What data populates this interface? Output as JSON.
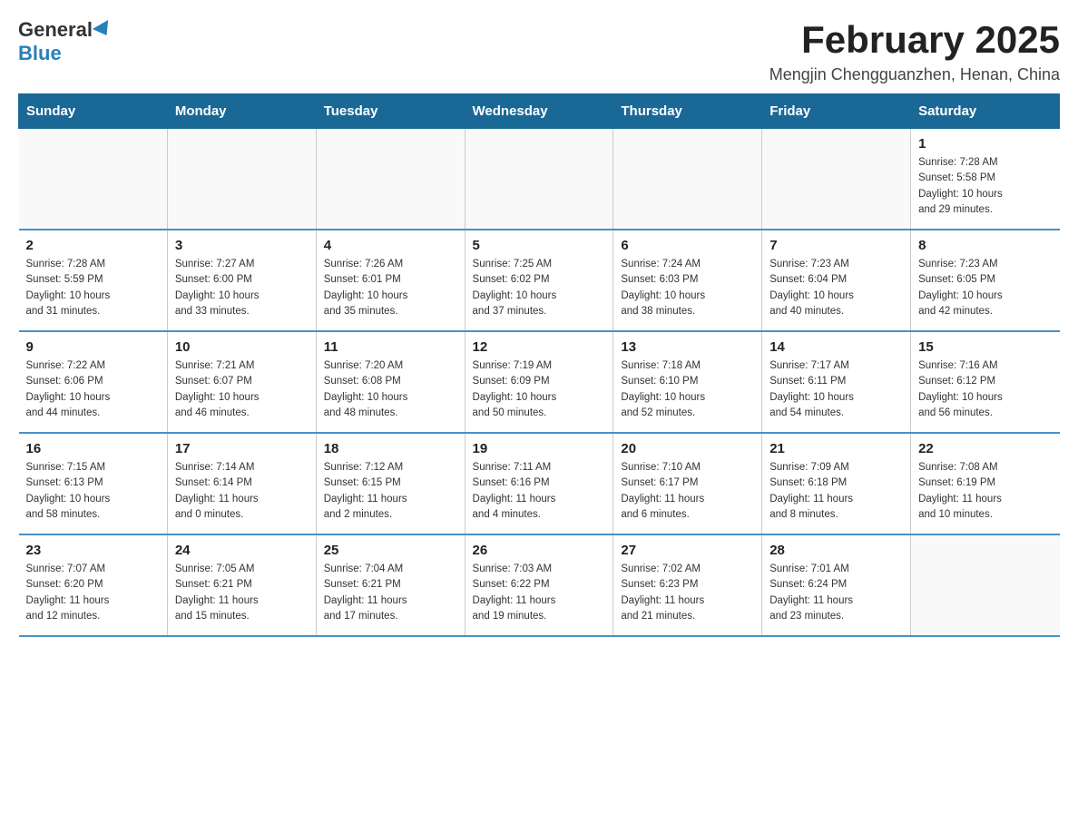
{
  "logo": {
    "general": "General",
    "blue": "Blue"
  },
  "title": "February 2025",
  "location": "Mengjin Chengguanzhen, Henan, China",
  "days_of_week": [
    "Sunday",
    "Monday",
    "Tuesday",
    "Wednesday",
    "Thursday",
    "Friday",
    "Saturday"
  ],
  "weeks": [
    {
      "days": [
        {
          "date": "",
          "info": ""
        },
        {
          "date": "",
          "info": ""
        },
        {
          "date": "",
          "info": ""
        },
        {
          "date": "",
          "info": ""
        },
        {
          "date": "",
          "info": ""
        },
        {
          "date": "",
          "info": ""
        },
        {
          "date": "1",
          "info": "Sunrise: 7:28 AM\nSunset: 5:58 PM\nDaylight: 10 hours\nand 29 minutes."
        }
      ]
    },
    {
      "days": [
        {
          "date": "2",
          "info": "Sunrise: 7:28 AM\nSunset: 5:59 PM\nDaylight: 10 hours\nand 31 minutes."
        },
        {
          "date": "3",
          "info": "Sunrise: 7:27 AM\nSunset: 6:00 PM\nDaylight: 10 hours\nand 33 minutes."
        },
        {
          "date": "4",
          "info": "Sunrise: 7:26 AM\nSunset: 6:01 PM\nDaylight: 10 hours\nand 35 minutes."
        },
        {
          "date": "5",
          "info": "Sunrise: 7:25 AM\nSunset: 6:02 PM\nDaylight: 10 hours\nand 37 minutes."
        },
        {
          "date": "6",
          "info": "Sunrise: 7:24 AM\nSunset: 6:03 PM\nDaylight: 10 hours\nand 38 minutes."
        },
        {
          "date": "7",
          "info": "Sunrise: 7:23 AM\nSunset: 6:04 PM\nDaylight: 10 hours\nand 40 minutes."
        },
        {
          "date": "8",
          "info": "Sunrise: 7:23 AM\nSunset: 6:05 PM\nDaylight: 10 hours\nand 42 minutes."
        }
      ]
    },
    {
      "days": [
        {
          "date": "9",
          "info": "Sunrise: 7:22 AM\nSunset: 6:06 PM\nDaylight: 10 hours\nand 44 minutes."
        },
        {
          "date": "10",
          "info": "Sunrise: 7:21 AM\nSunset: 6:07 PM\nDaylight: 10 hours\nand 46 minutes."
        },
        {
          "date": "11",
          "info": "Sunrise: 7:20 AM\nSunset: 6:08 PM\nDaylight: 10 hours\nand 48 minutes."
        },
        {
          "date": "12",
          "info": "Sunrise: 7:19 AM\nSunset: 6:09 PM\nDaylight: 10 hours\nand 50 minutes."
        },
        {
          "date": "13",
          "info": "Sunrise: 7:18 AM\nSunset: 6:10 PM\nDaylight: 10 hours\nand 52 minutes."
        },
        {
          "date": "14",
          "info": "Sunrise: 7:17 AM\nSunset: 6:11 PM\nDaylight: 10 hours\nand 54 minutes."
        },
        {
          "date": "15",
          "info": "Sunrise: 7:16 AM\nSunset: 6:12 PM\nDaylight: 10 hours\nand 56 minutes."
        }
      ]
    },
    {
      "days": [
        {
          "date": "16",
          "info": "Sunrise: 7:15 AM\nSunset: 6:13 PM\nDaylight: 10 hours\nand 58 minutes."
        },
        {
          "date": "17",
          "info": "Sunrise: 7:14 AM\nSunset: 6:14 PM\nDaylight: 11 hours\nand 0 minutes."
        },
        {
          "date": "18",
          "info": "Sunrise: 7:12 AM\nSunset: 6:15 PM\nDaylight: 11 hours\nand 2 minutes."
        },
        {
          "date": "19",
          "info": "Sunrise: 7:11 AM\nSunset: 6:16 PM\nDaylight: 11 hours\nand 4 minutes."
        },
        {
          "date": "20",
          "info": "Sunrise: 7:10 AM\nSunset: 6:17 PM\nDaylight: 11 hours\nand 6 minutes."
        },
        {
          "date": "21",
          "info": "Sunrise: 7:09 AM\nSunset: 6:18 PM\nDaylight: 11 hours\nand 8 minutes."
        },
        {
          "date": "22",
          "info": "Sunrise: 7:08 AM\nSunset: 6:19 PM\nDaylight: 11 hours\nand 10 minutes."
        }
      ]
    },
    {
      "days": [
        {
          "date": "23",
          "info": "Sunrise: 7:07 AM\nSunset: 6:20 PM\nDaylight: 11 hours\nand 12 minutes."
        },
        {
          "date": "24",
          "info": "Sunrise: 7:05 AM\nSunset: 6:21 PM\nDaylight: 11 hours\nand 15 minutes."
        },
        {
          "date": "25",
          "info": "Sunrise: 7:04 AM\nSunset: 6:21 PM\nDaylight: 11 hours\nand 17 minutes."
        },
        {
          "date": "26",
          "info": "Sunrise: 7:03 AM\nSunset: 6:22 PM\nDaylight: 11 hours\nand 19 minutes."
        },
        {
          "date": "27",
          "info": "Sunrise: 7:02 AM\nSunset: 6:23 PM\nDaylight: 11 hours\nand 21 minutes."
        },
        {
          "date": "28",
          "info": "Sunrise: 7:01 AM\nSunset: 6:24 PM\nDaylight: 11 hours\nand 23 minutes."
        },
        {
          "date": "",
          "info": ""
        }
      ]
    }
  ]
}
